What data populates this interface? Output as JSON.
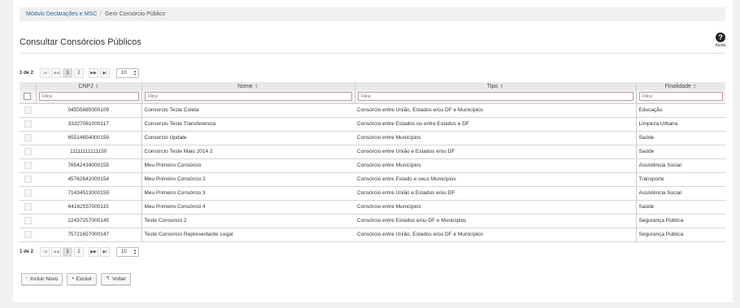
{
  "breadcrumb": {
    "root": "Módulo Declarações e MSC",
    "separator": "/",
    "current": "Gerir Consórcio Público"
  },
  "page_title": "Consultar Consórcios Públicos",
  "help": {
    "icon": "?",
    "label": "Ajuda"
  },
  "pager": {
    "info": "1 de 2",
    "first": "|◀",
    "prev": "◀◀",
    "pages": [
      "1",
      "2"
    ],
    "next": "▶▶",
    "last": "▶|",
    "page_size": "10"
  },
  "table": {
    "columns": [
      "CNPJ",
      "Nome",
      "Tipo",
      "Finalidade"
    ],
    "sort_icon": "⇕",
    "filter_placeholder": "Filtrar",
    "rows": [
      {
        "cnpj": "04555885000109",
        "nome": "Consorcio Teste Coleta",
        "tipo": "Consórcio entre União, Estados e/ou DF e Municípios",
        "finalidade": "Educação"
      },
      {
        "cnpj": "33327061000117",
        "nome": "Consorcio Teste Transferencia",
        "tipo": "Consórcio entre Estados ou entre Estados e DF",
        "finalidade": "Limpeza Urbana"
      },
      {
        "cnpj": "65514654000159",
        "nome": "Consorcio Update",
        "tipo": "Consórcio entre Municípios",
        "finalidade": "Saúde"
      },
      {
        "cnpj": "11111111111150",
        "nome": "Consórcio Teste Maio 2014 2",
        "tipo": "Consórcio entre União e Estados e/ou DF",
        "finalidade": "Saúde"
      },
      {
        "cnpj": "76542434000155",
        "nome": "Meu Primeiro Consórcio",
        "tipo": "Consórcio entre Municípios",
        "finalidade": "Assistência Social"
      },
      {
        "cnpj": "45762642000154",
        "nome": "Meu Primeiro Consórcio 2",
        "tipo": "Consórcio entre Estado e seus Municípios",
        "finalidade": "Transporte"
      },
      {
        "cnpj": "71434513000159",
        "nome": "Meu Primeiro Consórcio 3",
        "tipo": "Consórcio entre União e Estados e/ou DF",
        "finalidade": "Assistência Social"
      },
      {
        "cnpj": "64162557000115",
        "nome": "Meu Primeiro Consórcio 4",
        "tipo": "Consórcio entre Municípios",
        "finalidade": "Saúde"
      },
      {
        "cnpj": "22437257000145",
        "nome": "Teste Consorcio 2",
        "tipo": "Consórcio entre Estados e/ou DF e Municípios",
        "finalidade": "Segurança Pública"
      },
      {
        "cnpj": "75721657000147",
        "nome": "Teste Consorcio Representante Legal",
        "tipo": "Consórcio entre União, Estados e/ou DF e Municípios",
        "finalidade": "Segurança Pública"
      }
    ]
  },
  "actions": {
    "incluir": {
      "label": "Incluir Novo",
      "icon": "▫"
    },
    "excluir": {
      "label": "Excluir",
      "icon": "▪"
    },
    "voltar": {
      "label": "Voltar",
      "icon": "↰"
    }
  }
}
